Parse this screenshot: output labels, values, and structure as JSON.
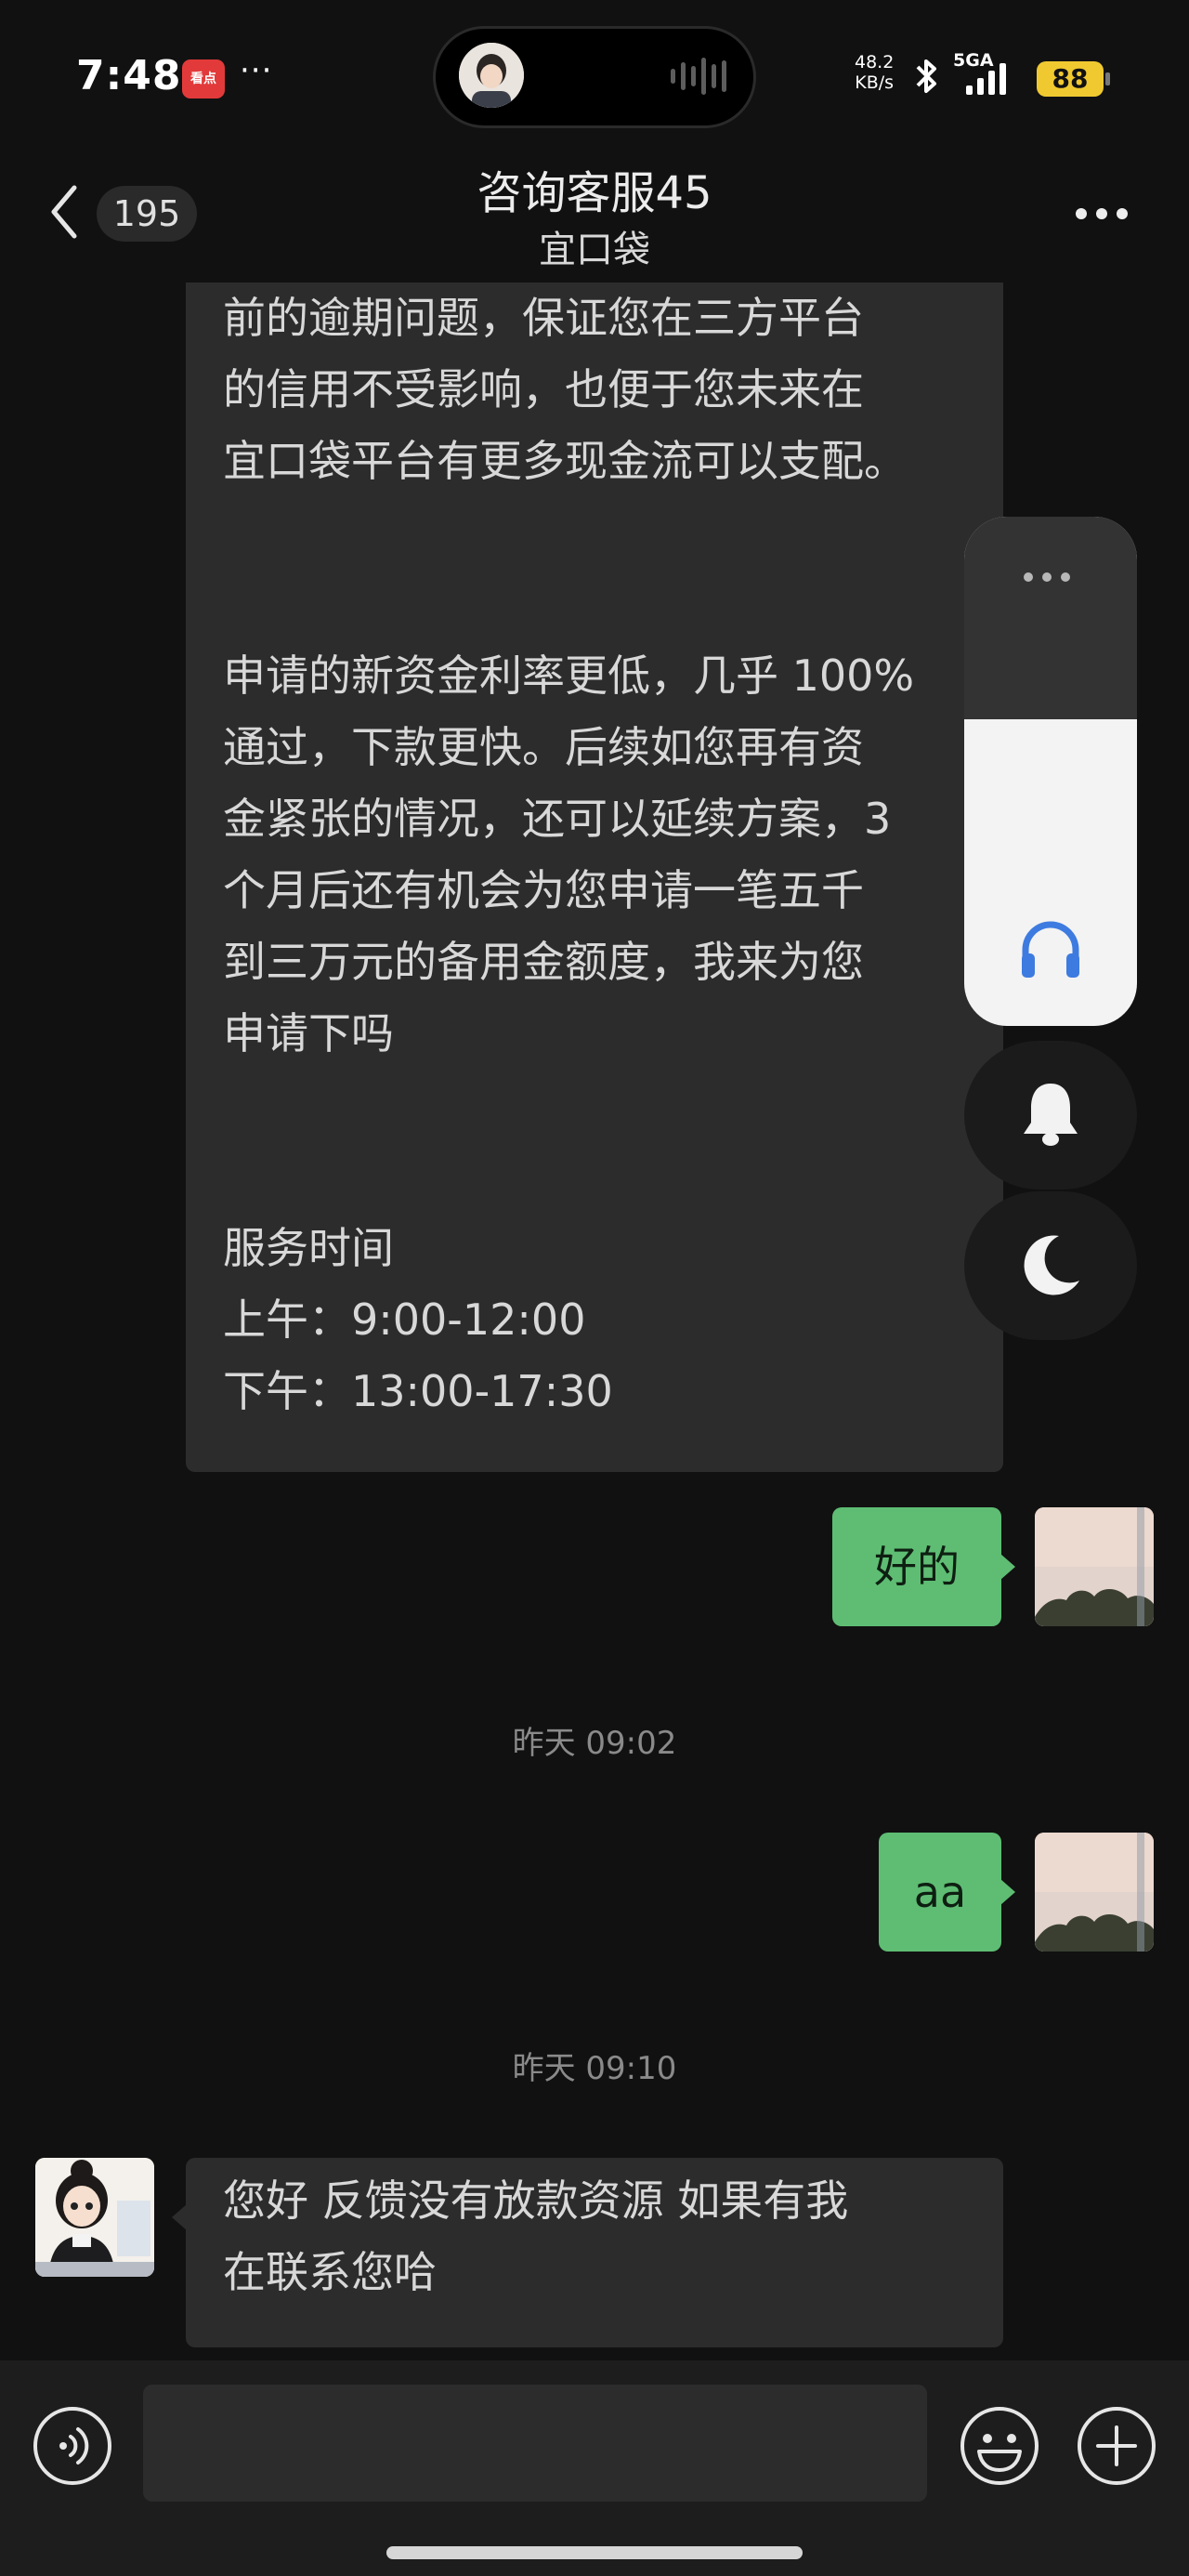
{
  "status_bar": {
    "time": "7:48",
    "app_badge": "看点",
    "dots": "···",
    "net_speed_value": "48.2",
    "net_speed_unit": "KB/s",
    "signal": "5GA",
    "battery": "88"
  },
  "header": {
    "unread_count": "195",
    "title": "咨询客服45",
    "subtitle": "宜口袋"
  },
  "messages": {
    "agent_long": {
      "lines": [
        "前的逾期问题，保证您在三方平台",
        "的信用不受影响，也便于您未来在",
        "宜口袋平台有更多现金流可以支配。",
        "",
        "",
        "申请的新资金利率更低，几乎 100%",
        "通过，下款更快。后续如您再有资",
        "金紧张的情况，还可以延续方案，3",
        "个月后还有机会为您申请一笔五千",
        "到三万元的备用金额度，我来为您",
        "申请下吗",
        "",
        "",
        "服务时间",
        "上午：9:00-12:00",
        "下午：13:00-17:30"
      ]
    },
    "me_1": "好的",
    "time_1": "昨天 09:02",
    "me_2": "aa",
    "time_2": "昨天 09:10",
    "agent_last": {
      "lines": [
        "您好 反馈没有放款资源  如果有我",
        "在联系您哈"
      ]
    }
  },
  "input_bar": {
    "voice_icon": "voice-icon",
    "emoji_icon": "emoji-icon",
    "plus_icon": "plus-icon",
    "value": ""
  },
  "colors": {
    "background": "#111111",
    "bubble_incoming": "#2c2c2c",
    "bubble_outgoing": "#5ebd73",
    "accent_blue": "#3d7be0",
    "battery": "#f0c931"
  }
}
